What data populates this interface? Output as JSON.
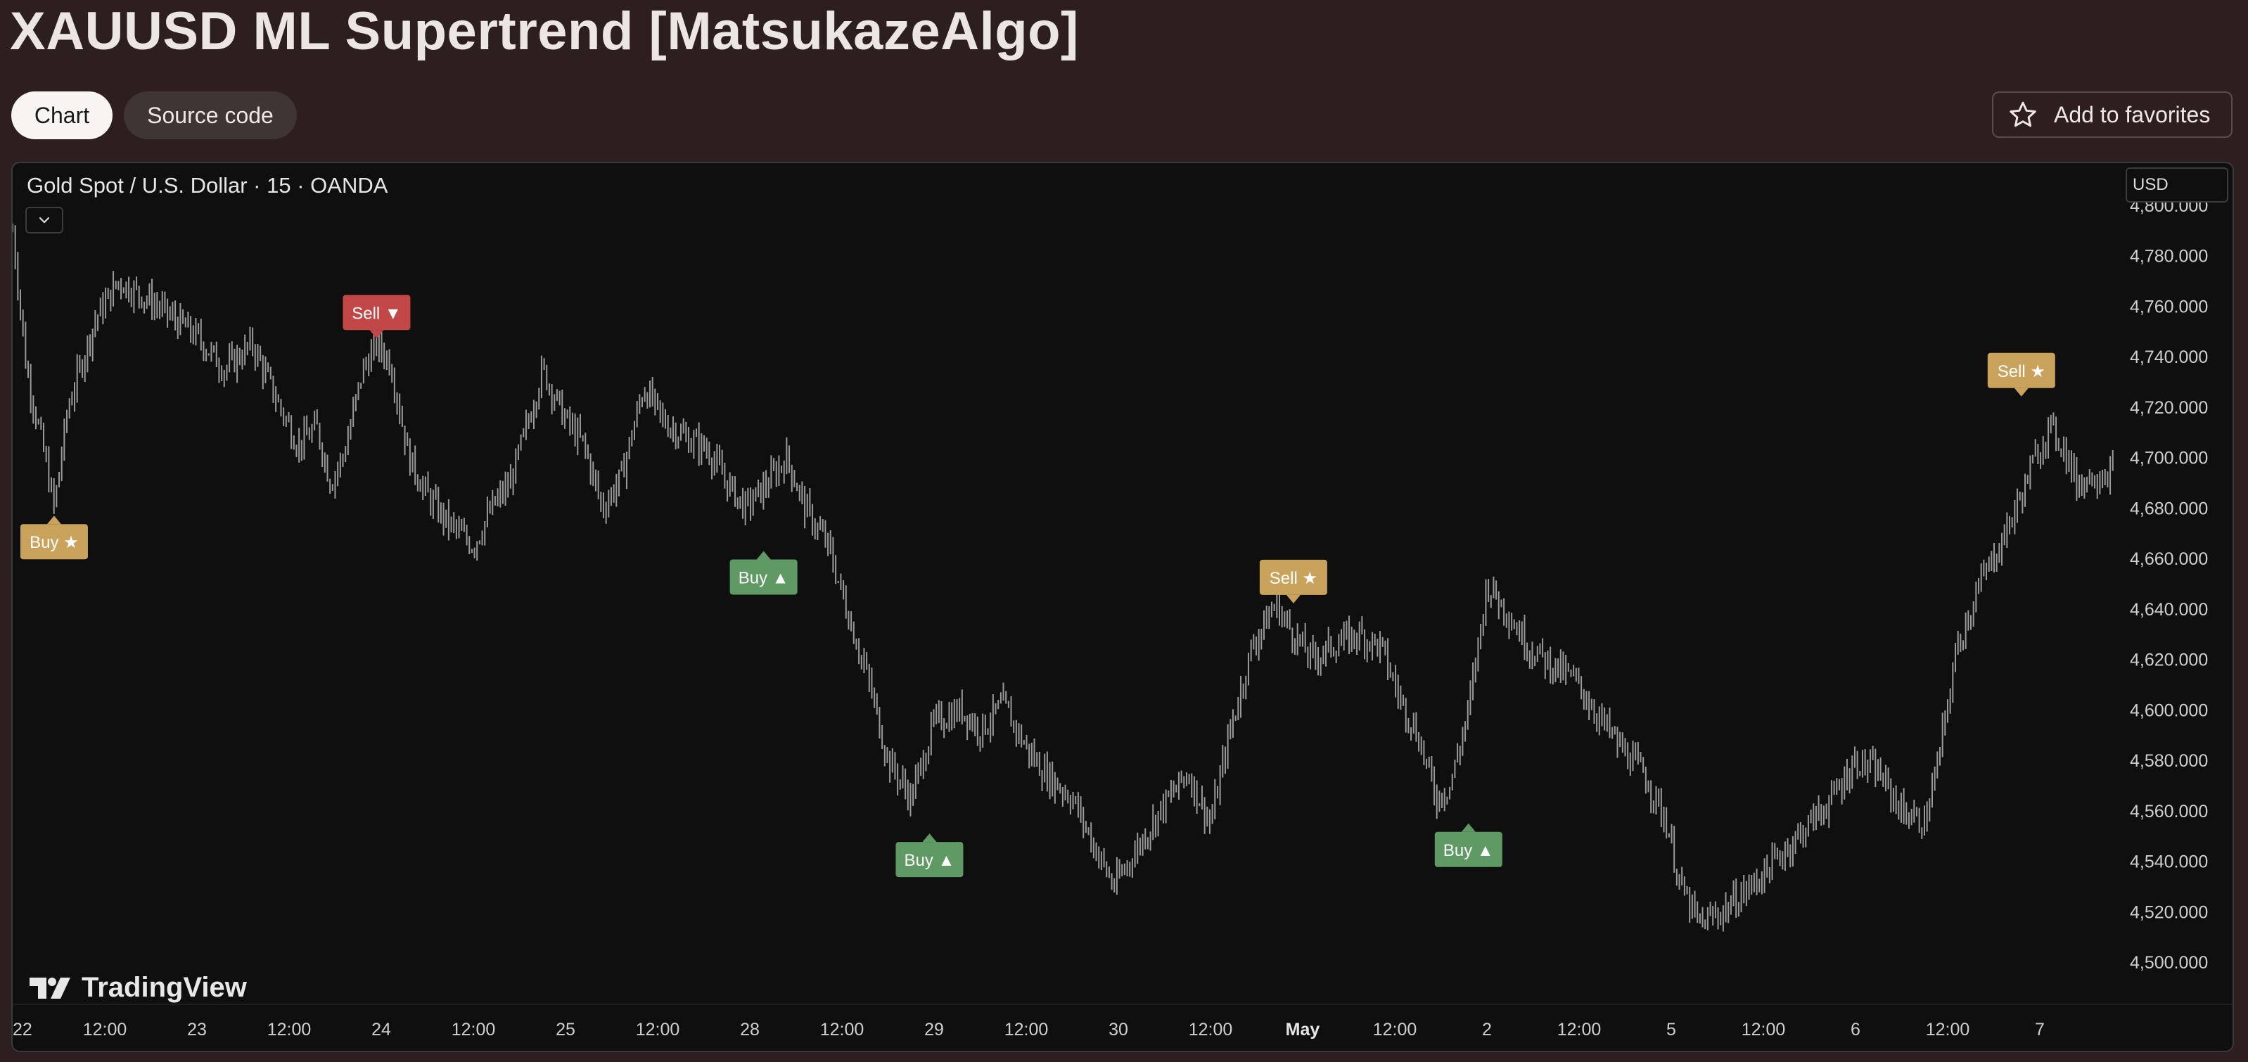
{
  "page": {
    "title": "XAUUSD ML Supertrend [MatsukazeAlgo]",
    "tabs": [
      {
        "label": "Chart",
        "active": true
      },
      {
        "label": "Source code",
        "active": false
      }
    ],
    "favorites_label": "Add to favorites",
    "favorites_icon": "star-outline-icon"
  },
  "chart_header": {
    "symbol_title": "Gold Spot / U.S. Dollar · 15 · OANDA",
    "currency": "USD",
    "collapse_icon": "chevron-down-icon"
  },
  "branding": {
    "logo_text": "TradingView"
  },
  "colors": {
    "background": "#0f0f0f",
    "candles": "#9a9a9a",
    "buy_trend": "#5f9a65",
    "sell_trend": "#c24848",
    "star_signal": "#c9a35b"
  },
  "chart_data": {
    "type": "line",
    "title": "",
    "xlabel": "",
    "ylabel": "",
    "ylim": [
      4490,
      4800
    ],
    "y_ticks": [
      "4,500.000",
      "4,520.000",
      "4,540.000",
      "4,560.000",
      "4,580.000",
      "4,600.000",
      "4,620.000",
      "4,640.000",
      "4,660.000",
      "4,680.000",
      "4,700.000",
      "4,720.000",
      "4,740.000",
      "4,760.000",
      "4,780.000",
      "4,800.000"
    ],
    "x_ticks": [
      "22",
      "12:00",
      "23",
      "12:00",
      "24",
      "12:00",
      "25",
      "12:00",
      "28",
      "12:00",
      "29",
      "12:00",
      "30",
      "12:00",
      "May",
      "12:00",
      "2",
      "12:00",
      "5",
      "12:00",
      "6",
      "12:00",
      "7"
    ],
    "x_range": [
      0,
      22.8
    ],
    "series": [
      {
        "values": [
          [
            0.0,
            4790
          ],
          [
            0.15,
            4735
          ],
          [
            0.35,
            4700
          ],
          [
            0.45,
            4680
          ],
          [
            0.6,
            4720
          ],
          [
            0.9,
            4755
          ],
          [
            1.15,
            4770
          ],
          [
            1.5,
            4762
          ],
          [
            1.75,
            4755
          ],
          [
            2.0,
            4748
          ],
          [
            2.3,
            4735
          ],
          [
            2.6,
            4745
          ],
          [
            2.9,
            4720
          ],
          [
            3.1,
            4705
          ],
          [
            3.3,
            4712
          ],
          [
            3.45,
            4690
          ],
          [
            3.6,
            4702
          ],
          [
            3.8,
            4735
          ],
          [
            3.95,
            4745
          ],
          [
            4.1,
            4738
          ],
          [
            4.3,
            4700
          ],
          [
            4.5,
            4685
          ],
          [
            4.7,
            4675
          ],
          [
            5.0,
            4665
          ],
          [
            5.2,
            4680
          ],
          [
            5.4,
            4690
          ],
          [
            5.6,
            4715
          ],
          [
            5.75,
            4735
          ],
          [
            6.0,
            4715
          ],
          [
            6.2,
            4705
          ],
          [
            6.4,
            4680
          ],
          [
            6.6,
            4692
          ],
          [
            6.85,
            4728
          ],
          [
            7.05,
            4715
          ],
          [
            7.3,
            4708
          ],
          [
            7.55,
            4703
          ],
          [
            7.75,
            4690
          ],
          [
            7.95,
            4680
          ],
          [
            8.15,
            4688
          ],
          [
            8.4,
            4700
          ],
          [
            8.6,
            4680
          ],
          [
            8.85,
            4665
          ],
          [
            9.05,
            4640
          ],
          [
            9.3,
            4610
          ],
          [
            9.5,
            4580
          ],
          [
            9.75,
            4565
          ],
          [
            10.0,
            4595
          ],
          [
            10.3,
            4600
          ],
          [
            10.5,
            4592
          ],
          [
            10.75,
            4602
          ],
          [
            11.0,
            4585
          ],
          [
            11.2,
            4575
          ],
          [
            11.5,
            4565
          ],
          [
            11.75,
            4545
          ],
          [
            11.95,
            4530
          ],
          [
            12.2,
            4545
          ],
          [
            12.45,
            4560
          ],
          [
            12.75,
            4575
          ],
          [
            13.0,
            4555
          ],
          [
            13.2,
            4590
          ],
          [
            13.45,
            4625
          ],
          [
            13.7,
            4642
          ],
          [
            13.9,
            4630
          ],
          [
            14.1,
            4620
          ],
          [
            14.3,
            4625
          ],
          [
            14.6,
            4630
          ],
          [
            14.85,
            4625
          ],
          [
            15.05,
            4605
          ],
          [
            15.25,
            4590
          ],
          [
            15.45,
            4565
          ],
          [
            15.6,
            4570
          ],
          [
            15.8,
            4600
          ],
          [
            16.0,
            4650
          ],
          [
            16.2,
            4640
          ],
          [
            16.45,
            4625
          ],
          [
            16.7,
            4618
          ],
          [
            16.95,
            4612
          ],
          [
            17.2,
            4598
          ],
          [
            17.45,
            4585
          ],
          [
            17.7,
            4575
          ],
          [
            17.95,
            4555
          ],
          [
            18.1,
            4530
          ],
          [
            18.3,
            4515
          ],
          [
            18.55,
            4520
          ],
          [
            18.8,
            4528
          ],
          [
            19.0,
            4535
          ],
          [
            19.25,
            4545
          ],
          [
            19.5,
            4555
          ],
          [
            19.75,
            4565
          ],
          [
            20.0,
            4580
          ],
          [
            20.25,
            4575
          ],
          [
            20.5,
            4560
          ],
          [
            20.75,
            4555
          ],
          [
            20.9,
            4580
          ],
          [
            21.1,
            4625
          ],
          [
            21.35,
            4650
          ],
          [
            21.6,
            4668
          ],
          [
            21.8,
            4685
          ],
          [
            21.95,
            4700
          ],
          [
            22.1,
            4712
          ],
          [
            22.25,
            4705
          ],
          [
            22.4,
            4690
          ],
          [
            22.6,
            4693
          ],
          [
            22.8,
            4695
          ]
        ]
      }
    ],
    "signals": [
      {
        "label": "Buy ★",
        "x": 0.45,
        "y": 4682,
        "style": "star",
        "placement": "below"
      },
      {
        "label": "Sell ▼",
        "x": 3.95,
        "y": 4745,
        "style": "sell",
        "placement": "above"
      },
      {
        "label": "Buy ▲",
        "x": 8.15,
        "y": 4668,
        "style": "buy",
        "placement": "below"
      },
      {
        "label": "Buy ▲",
        "x": 9.95,
        "y": 4556,
        "style": "buy",
        "placement": "below"
      },
      {
        "label": "Sell ★",
        "x": 13.9,
        "y": 4640,
        "style": "star",
        "placement": "above"
      },
      {
        "label": "Buy ▲",
        "x": 15.8,
        "y": 4560,
        "style": "buy",
        "placement": "below"
      },
      {
        "label": "Sell ★",
        "x": 21.8,
        "y": 4722,
        "style": "star",
        "placement": "above"
      }
    ],
    "grid": false,
    "legend": "none"
  }
}
